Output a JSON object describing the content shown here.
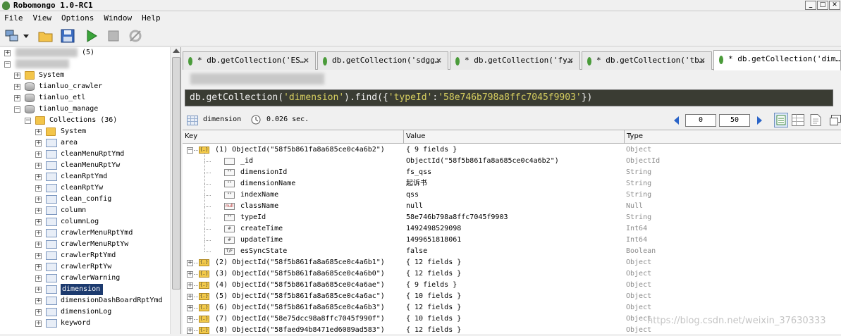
{
  "window": {
    "title": "Robomongo 1.0-RC1"
  },
  "menu": [
    "File",
    "View",
    "Options",
    "Window",
    "Help"
  ],
  "sidebar": {
    "server_count": "(5)",
    "nodes": [
      {
        "label": "System",
        "icon": "folder-icon",
        "level": 1
      },
      {
        "label": "tianluo_crawler",
        "icon": "database-icon",
        "level": 1
      },
      {
        "label": "tianluo_etl",
        "icon": "database-icon",
        "level": 1
      },
      {
        "label": "tianluo_manage",
        "icon": "database-icon",
        "level": 1
      },
      {
        "label": "Collections (36)",
        "icon": "folder-icon",
        "level": 2
      },
      {
        "label": "System",
        "icon": "folder-icon",
        "level": 3
      },
      {
        "label": "area",
        "icon": "collection-icon",
        "level": 3
      },
      {
        "label": "cleanMenuRptYmd",
        "icon": "collection-icon",
        "level": 3
      },
      {
        "label": "cleanMenuRptYw",
        "icon": "collection-icon",
        "level": 3
      },
      {
        "label": "cleanRptYmd",
        "icon": "collection-icon",
        "level": 3
      },
      {
        "label": "cleanRptYw",
        "icon": "collection-icon",
        "level": 3
      },
      {
        "label": "clean_config",
        "icon": "collection-icon",
        "level": 3
      },
      {
        "label": "column",
        "icon": "collection-icon",
        "level": 3
      },
      {
        "label": "columnLog",
        "icon": "collection-icon",
        "level": 3
      },
      {
        "label": "crawlerMenuRptYmd",
        "icon": "collection-icon",
        "level": 3
      },
      {
        "label": "crawlerMenuRptYw",
        "icon": "collection-icon",
        "level": 3
      },
      {
        "label": "crawlerRptYmd",
        "icon": "collection-icon",
        "level": 3
      },
      {
        "label": "crawlerRptYw",
        "icon": "collection-icon",
        "level": 3
      },
      {
        "label": "crawlerWarning",
        "icon": "collection-icon",
        "level": 3
      },
      {
        "label": "dimension",
        "icon": "collection-icon",
        "level": 3,
        "selected": true
      },
      {
        "label": "dimensionDashBoardRptYmd",
        "icon": "collection-icon",
        "level": 3
      },
      {
        "label": "dimensionLog",
        "icon": "collection-icon",
        "level": 3
      },
      {
        "label": "keyword",
        "icon": "collection-icon",
        "level": 3
      }
    ]
  },
  "tabs": [
    {
      "label": "* db.getCollection('ES…",
      "active": false
    },
    {
      "label": "db.getCollection('sdgg…",
      "active": false
    },
    {
      "label": "* db.getCollection('fy…",
      "active": false
    },
    {
      "label": "* db.getCollection('tb…",
      "active": false
    },
    {
      "label": "* db.getCollection('dim…",
      "active": true
    }
  ],
  "query": {
    "prefix": "db.getCollection(",
    "collection": "'dimension'",
    "mid": ").find({",
    "key": "'typeId'",
    "colon": ":",
    "value": "'58e746b798a8ffc7045f9903'",
    "suffix": "})"
  },
  "results_bar": {
    "collection": "dimension",
    "time": "0.026 sec.",
    "skip": "0",
    "limit": "50"
  },
  "grid": {
    "headers": {
      "key": "Key",
      "value": "Value",
      "type": "Type"
    },
    "rows": [
      {
        "key": "(1) ObjectId(\"58f5b861fa8a685ce0c4a6b2\")",
        "value": "{ 9 fields }",
        "type": "Object",
        "icon": "object-icon",
        "expanded": true,
        "level": 0
      },
      {
        "key": "_id",
        "value": "ObjectId(\"58f5b861fa8a685ce0c4a6b2\")",
        "type": "ObjectId",
        "icon": "objectid-icon",
        "level": 1
      },
      {
        "key": "dimensionId",
        "value": "fs_qss",
        "type": "String",
        "icon": "string-icon",
        "level": 1
      },
      {
        "key": "dimensionName",
        "value": "起诉书",
        "type": "String",
        "icon": "string-icon",
        "level": 1
      },
      {
        "key": "indexName",
        "value": "qss",
        "type": "String",
        "icon": "string-icon",
        "level": 1
      },
      {
        "key": "className",
        "value": "null",
        "type": "Null",
        "icon": "null-icon",
        "level": 1
      },
      {
        "key": "typeId",
        "value": "58e746b798a8ffc7045f9903",
        "type": "String",
        "icon": "string-icon",
        "level": 1
      },
      {
        "key": "createTime",
        "value": "1492498529098",
        "type": "Int64",
        "icon": "int-icon",
        "level": 1
      },
      {
        "key": "updateTime",
        "value": "1499651818061",
        "type": "Int64",
        "icon": "int-icon",
        "level": 1
      },
      {
        "key": "esSyncState",
        "value": "false",
        "type": "Boolean",
        "icon": "boolean-icon",
        "level": 1
      },
      {
        "key": "(2) ObjectId(\"58f5b861fa8a685ce0c4a6b1\")",
        "value": "{ 12 fields }",
        "type": "Object",
        "icon": "object-icon",
        "level": 0
      },
      {
        "key": "(3) ObjectId(\"58f5b861fa8a685ce0c4a6b0\")",
        "value": "{ 12 fields }",
        "type": "Object",
        "icon": "object-icon",
        "level": 0
      },
      {
        "key": "(4) ObjectId(\"58f5b861fa8a685ce0c4a6ae\")",
        "value": "{ 9 fields }",
        "type": "Object",
        "icon": "object-icon",
        "level": 0
      },
      {
        "key": "(5) ObjectId(\"58f5b861fa8a685ce0c4a6ac\")",
        "value": "{ 10 fields }",
        "type": "Object",
        "icon": "object-icon",
        "level": 0
      },
      {
        "key": "(6) ObjectId(\"58f5b861fa8a685ce0c4a6b3\")",
        "value": "{ 12 fields }",
        "type": "Object",
        "icon": "object-icon",
        "level": 0
      },
      {
        "key": "(7) ObjectId(\"58e75dcc98a8ffc7045f990f\")",
        "value": "{ 10 fields }",
        "type": "Object",
        "icon": "object-icon",
        "level": 0
      },
      {
        "key": "(8) ObjectId(\"58faed94b8471ed6089ad583\")",
        "value": "{ 12 fields }",
        "type": "Object",
        "icon": "object-icon",
        "level": 0
      }
    ]
  },
  "watermark": "https://blog.csdn.net/weixin_37630333",
  "colors": {
    "selection": "#1c3a6e",
    "query_bg": "#3a3c33",
    "string_literal": "#d8d060",
    "type_text": "#8a8a8a"
  }
}
